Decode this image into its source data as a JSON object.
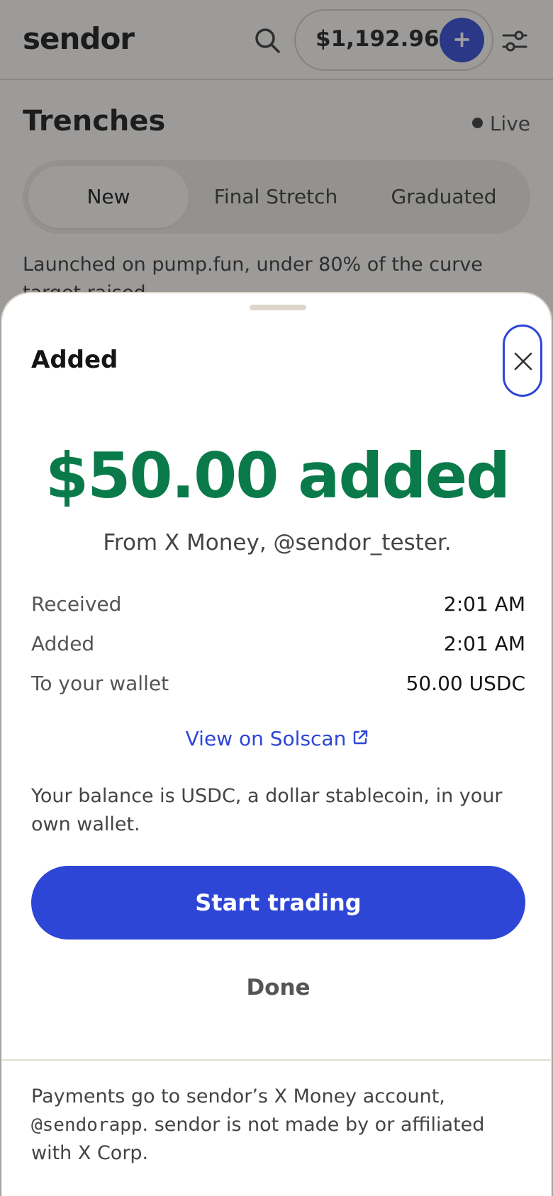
{
  "header": {
    "logo": "sendor",
    "balance": "$1,192.96",
    "add_symbol": "+"
  },
  "page": {
    "title": "Trenches",
    "live_label": "Live",
    "tabs": [
      {
        "label": "New",
        "active": true
      },
      {
        "label": "Final Stretch",
        "active": false
      },
      {
        "label": "Graduated",
        "active": false
      }
    ],
    "description": "Launched on pump.fun, under 80% of the curve target raised."
  },
  "sheet": {
    "title": "Added",
    "amount_headline": "$50.00 added",
    "from_text": "From X Money, @sendor_tester.",
    "details": [
      {
        "label": "Received",
        "value": "2:01 AM"
      },
      {
        "label": "Added",
        "value": "2:01 AM"
      },
      {
        "label": "To your wallet",
        "value": "50.00 USDC"
      }
    ],
    "solscan_link": "View on Solscan",
    "balance_note": "Your balance is USDC, a dollar stablecoin, in your own wallet.",
    "primary_button": "Start trading",
    "done_button": "Done",
    "footer_prefix": "Payments go to sendor’s X Money account,",
    "footer_handle": "@sendorapp",
    "footer_suffix": ". sendor is not made by or affiliated with X Corp."
  },
  "colors": {
    "accent": "#2e46d6",
    "success": "#0a7a4a",
    "background": "#fbfaf7"
  },
  "icons": {
    "search": "search-icon",
    "filter": "sliders-icon",
    "close": "close-icon",
    "external": "external-link-icon"
  }
}
